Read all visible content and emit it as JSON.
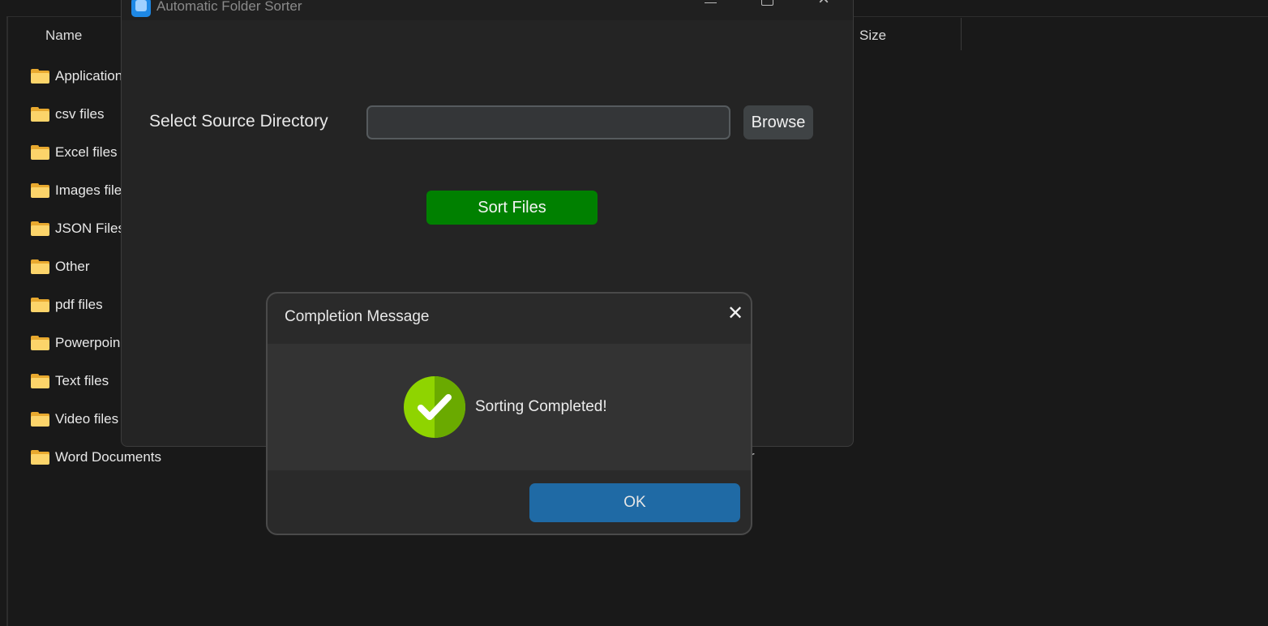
{
  "explorer": {
    "columns": {
      "name": "Name",
      "size": "Size"
    },
    "folders": [
      "Application",
      "csv files",
      "Excel files",
      "Images file",
      "JSON Files",
      "Other",
      "pdf files",
      "Powerpoin",
      "Text files",
      "Video files",
      "Word Documents"
    ],
    "stray_text": "r"
  },
  "app": {
    "title": "Automatic Folder Sorter",
    "source_label": "Select Source Directory",
    "source_value": "",
    "browse_label": "Browse",
    "sort_label": "Sort Files",
    "colors": {
      "sort_button": "#008000",
      "browse_button": "#3f4345"
    }
  },
  "dialog": {
    "title": "Completion Message",
    "message": "Sorting Completed!",
    "ok_label": "OK",
    "icon": "check-circle-icon",
    "colors": {
      "ok_button": "#1f6aa5",
      "check": "#8fd400"
    }
  }
}
